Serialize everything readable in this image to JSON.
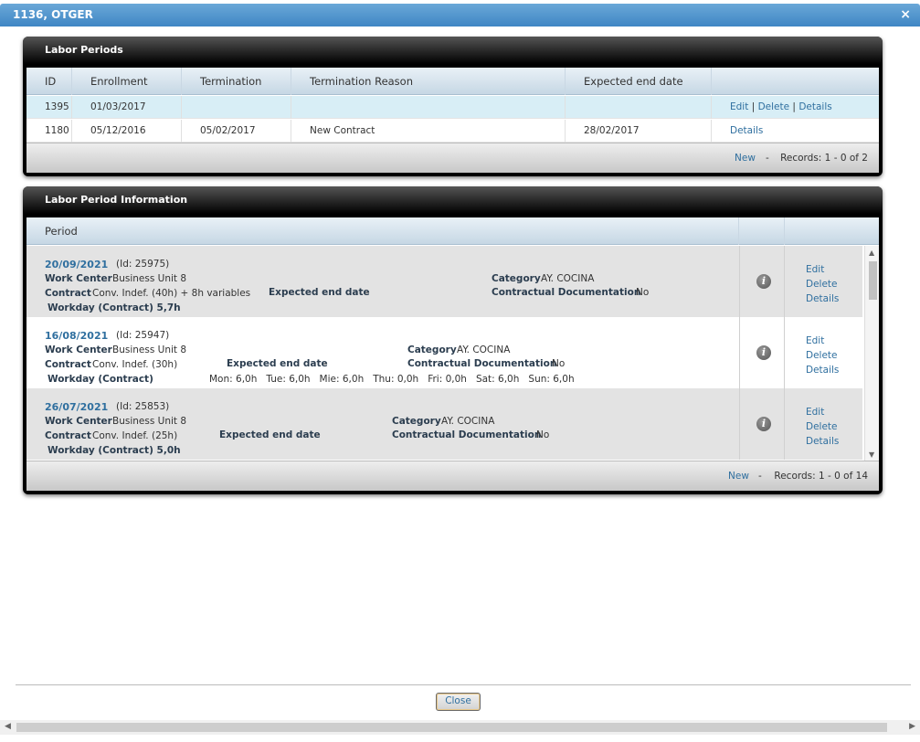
{
  "window": {
    "title": "1136, OTGER",
    "close_glyph": "×"
  },
  "labor_periods": {
    "title": "Labor Periods",
    "columns": [
      "ID",
      "Enrollment",
      "Termination",
      "Termination Reason",
      "Expected end date"
    ],
    "rows": [
      {
        "id": "1395",
        "enrollment": "01/03/2017",
        "termination": "",
        "reason": "",
        "expected_end": "",
        "actions": [
          "Edit",
          "Delete",
          "Details"
        ],
        "selected": true
      },
      {
        "id": "1180",
        "enrollment": "05/12/2016",
        "termination": "05/02/2017",
        "reason": "New Contract",
        "expected_end": "28/02/2017",
        "actions": [
          "Details"
        ],
        "selected": false
      }
    ],
    "separator": "|",
    "footer": {
      "new_label": "New",
      "dash": "-",
      "records": "Records: 1 - 0 of 2"
    }
  },
  "labor_period_info": {
    "title": "Labor Period Information",
    "column": "Period",
    "periods": [
      {
        "date": "20/09/2021",
        "id_text": "(Id: 25975)",
        "work_center_label": "Work Center",
        "work_center": "Business Unit 8",
        "contract_label": "Contract",
        "contract": "Conv. Indef. (40h) + 8h variables",
        "expected_label": "Expected end date",
        "expected": "-",
        "category_label": "Category",
        "category": "AY. COCINA",
        "doc_label": "Contractual Documentation",
        "doc": "No",
        "workday": "Workday (Contract) 5,7h",
        "schedule": ""
      },
      {
        "date": "16/08/2021",
        "id_text": "(Id: 25947)",
        "work_center_label": "Work Center",
        "work_center": "Business Unit 8",
        "contract_label": "Contract",
        "contract": "Conv. Indef. (30h)",
        "expected_label": "Expected end date",
        "expected": "-",
        "category_label": "Category",
        "category": "AY. COCINA",
        "doc_label": "Contractual Documentation",
        "doc": "No",
        "workday": "Workday (Contract)",
        "schedule": "Mon: 6,0h   Tue: 6,0h   Mie: 6,0h   Thu: 0,0h   Fri: 0,0h   Sat: 6,0h   Sun: 6,0h"
      },
      {
        "date": "26/07/2021",
        "id_text": "(Id: 25853)",
        "work_center_label": "Work Center",
        "work_center": "Business Unit 8",
        "contract_label": "Contract",
        "contract": "Conv. Indef. (25h)",
        "expected_label": "Expected end date",
        "expected": "-",
        "category_label": "Category",
        "category": "AY. COCINA",
        "doc_label": "Contractual Documentation",
        "doc": "No",
        "workday": "Workday (Contract) 5,0h",
        "schedule": ""
      }
    ],
    "actions": [
      "Edit",
      "Delete",
      "Details"
    ],
    "info_glyph": "i",
    "footer": {
      "new_label": "New",
      "dash": "-",
      "records": "Records: 1 - 0 of 14"
    }
  },
  "close_button": "Close",
  "icons": {
    "info": "info-icon",
    "close": "close-icon"
  },
  "colors": {
    "link": "#2f6f9f",
    "title_bar": "#3f86c4",
    "selected_row": "#d8eef6"
  }
}
